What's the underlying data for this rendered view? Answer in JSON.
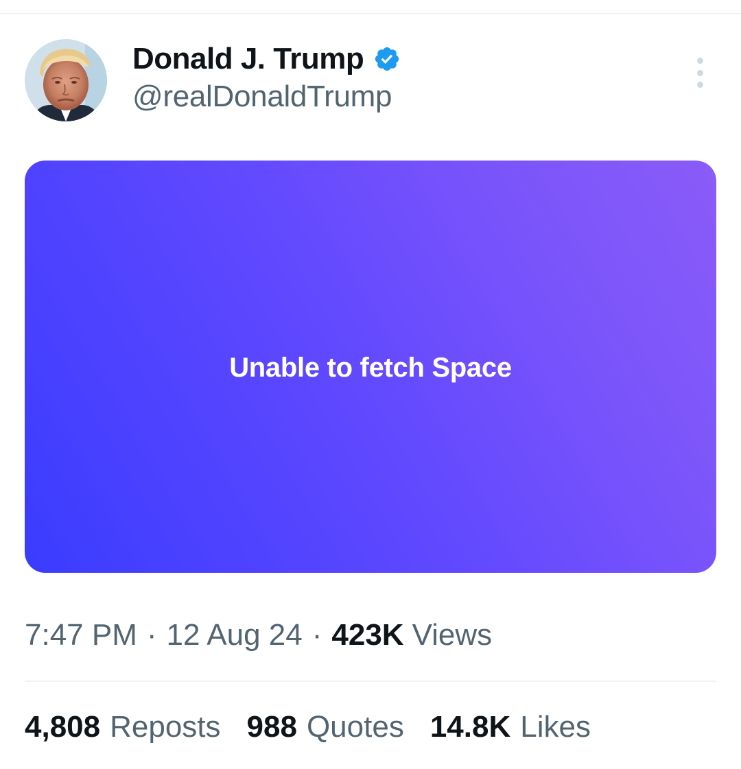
{
  "author": {
    "display_name": "Donald J. Trump",
    "handle": "@realDonaldTrump",
    "verified": true,
    "verified_color": "#1d9bf0"
  },
  "icons": {
    "verified": "verified-badge-icon",
    "more": "more-options-icon",
    "avatar": "profile-photo"
  },
  "space_card": {
    "message": "Unable to fetch Space",
    "gradient_start": "#3a3cff",
    "gradient_end": "#8a5cf8"
  },
  "meta": {
    "time": "7:47 PM",
    "separator": "·",
    "date": "12 Aug 24",
    "views_count": "423K",
    "views_label": "Views"
  },
  "stats": {
    "reposts_count": "4,808",
    "reposts_label": "Reposts",
    "quotes_count": "988",
    "quotes_label": "Quotes",
    "likes_count": "14.8K",
    "likes_label": "Likes"
  }
}
